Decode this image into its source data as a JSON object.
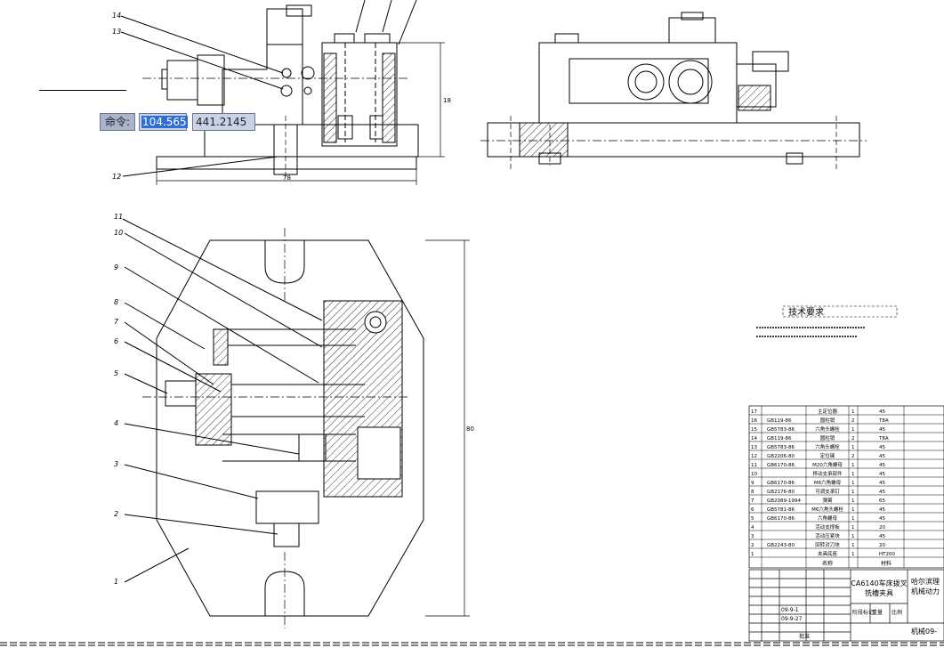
{
  "command_line": {
    "label": "命令:",
    "input_x": "104.565",
    "input_y": "441.2145"
  },
  "callouts": [
    "14",
    "13",
    "12",
    "11",
    "10",
    "9",
    "8",
    "7",
    "6",
    "5",
    "4",
    "3",
    "2",
    "1"
  ],
  "dimensions": {
    "top_width": "78",
    "top_height": "18",
    "bottom_height": "80"
  },
  "tech_requirements": {
    "title": "技术要求"
  },
  "parts_list": {
    "rows": [
      {
        "no": "17",
        "code": "",
        "name": "主定位器",
        "qty": "1",
        "mat": "45"
      },
      {
        "no": "16",
        "code": "GB119-86",
        "name": "圆柱销",
        "qty": "2",
        "mat": "T8A"
      },
      {
        "no": "15",
        "code": "GB5783-86",
        "name": "六角头螺栓",
        "qty": "1",
        "mat": "45"
      },
      {
        "no": "14",
        "code": "GB119-86",
        "name": "圆柱销",
        "qty": "2",
        "mat": "T8A"
      },
      {
        "no": "13",
        "code": "GB5783-86",
        "name": "六角头螺栓",
        "qty": "1",
        "mat": "45"
      },
      {
        "no": "12",
        "code": "GB2206-80",
        "name": "定位键",
        "qty": "2",
        "mat": "45"
      },
      {
        "no": "11",
        "code": "GB6170-86",
        "name": "M20六角螺母",
        "qty": "1",
        "mat": "45"
      },
      {
        "no": "10",
        "code": "",
        "name": "移动支承部件",
        "qty": "1",
        "mat": "45"
      },
      {
        "no": "9",
        "code": "GB6170-86",
        "name": "M6六角螺母",
        "qty": "1",
        "mat": "45"
      },
      {
        "no": "8",
        "code": "GB2176-80",
        "name": "可调支承钉",
        "qty": "1",
        "mat": "45"
      },
      {
        "no": "7",
        "code": "GB2089-1994",
        "name": "弹簧",
        "qty": "1",
        "mat": "65"
      },
      {
        "no": "6",
        "code": "GB5781-86",
        "name": "M6六角头螺栓",
        "qty": "1",
        "mat": "45"
      },
      {
        "no": "5",
        "code": "GB6170-86",
        "name": "六角螺母",
        "qty": "1",
        "mat": "45"
      },
      {
        "no": "4",
        "code": "",
        "name": "活动支撑板",
        "qty": "1",
        "mat": "20"
      },
      {
        "no": "3",
        "code": "",
        "name": "活动压紧块",
        "qty": "1",
        "mat": "45"
      },
      {
        "no": "2",
        "code": "GB2243-80",
        "name": "回转对刀块",
        "qty": "1",
        "mat": "20"
      },
      {
        "no": "1",
        "code": "",
        "name": "夹具底座",
        "qty": "1",
        "mat": "HT200"
      }
    ],
    "header": {
      "name": "名称",
      "material": "材料"
    }
  },
  "title_block": {
    "title": "CA6140车床拨叉\n铣槽夹具",
    "school": "哈尔滨理\n机械动力",
    "drawing_no": "机械09-",
    "scale_label": "阶段标记",
    "weight_label": "重量",
    "ratio_label": "比例",
    "date1": "09-9-1",
    "date2": "09-9-27",
    "approve_label": "批准"
  }
}
